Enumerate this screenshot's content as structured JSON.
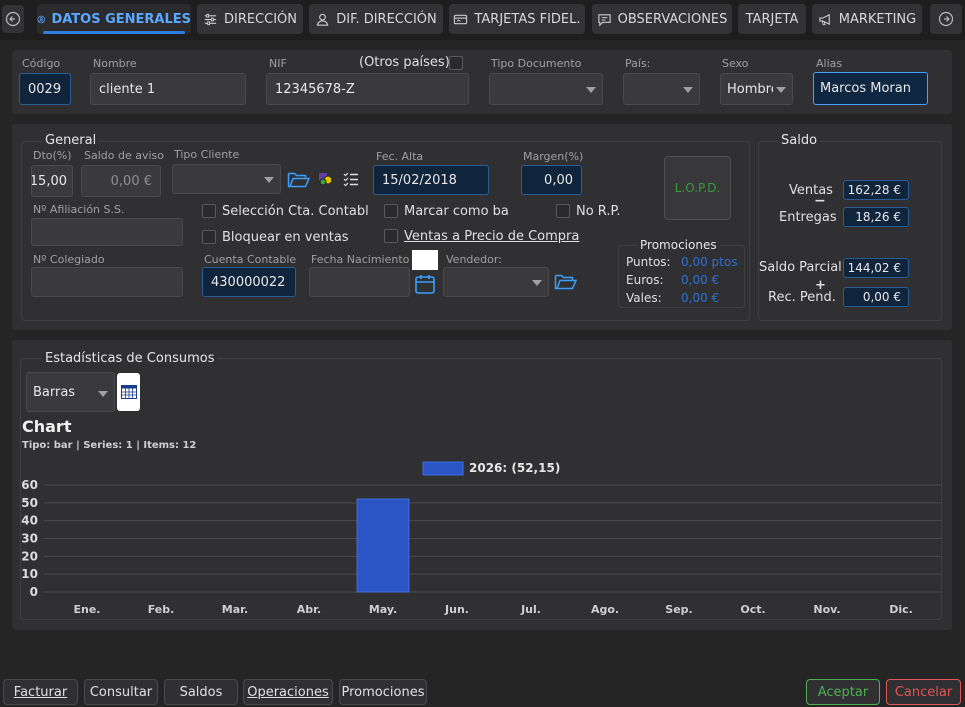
{
  "tabs": [
    {
      "label": "DATOS GENERALES",
      "icon": "user-circle-icon"
    },
    {
      "label": "DIRECCIÓN",
      "icon": "sliders-icon"
    },
    {
      "label": "DIF. DIRECCIÓN",
      "icon": "user-icon"
    },
    {
      "label": "TARJETAS FIDEL.",
      "icon": "card-icon"
    },
    {
      "label": "OBSERVACIONES",
      "icon": "note-icon"
    },
    {
      "label": "TARJETA",
      "icon": ""
    },
    {
      "label": "MARKETING",
      "icon": "megaphone-icon"
    }
  ],
  "header": {
    "codigo_label": "Código",
    "codigo": "0029",
    "nombre_label": "Nombre",
    "nombre": "cliente 1",
    "nif_label": "NIF",
    "nif": "12345678-Z",
    "otros_paises_label": "(Otros países)",
    "tipo_doc_label": "Tipo Documento",
    "tipo_doc": "",
    "pais_label": "País:",
    "pais": "",
    "sexo_label": "Sexo",
    "sexo": "Hombre",
    "alias_label": "Alias",
    "alias": "Marcos Moran"
  },
  "general": {
    "title": "General",
    "dto_label": "Dto(%)",
    "dto": "15,00",
    "saldo_aviso_label": "Saldo de aviso",
    "saldo_aviso": "0,00 €",
    "tipo_cliente_label": "Tipo Cliente",
    "tipo_cliente": "",
    "fec_alta_label": "Fec. Alta",
    "fec_alta": "15/02/2018",
    "margen_label": "Margen(%)",
    "margen": "0,00",
    "lopd": "L.O.P.D.",
    "afiliacion_label": "Nº Afiliación S.S.",
    "afiliacion": "",
    "colegiado_label": "Nº Colegiado",
    "colegiado": "",
    "seleccion_cta": "Selección Cta. Contabl",
    "bloquear_ventas": "Bloquear en ventas",
    "marcar_como": "Marcar como ba",
    "ventas_precio_compra": "Ventas a Precio de Compra",
    "no_rp": "No R.P.",
    "cuenta_contable_label": "Cuenta Contable",
    "cuenta_contable": "430000022",
    "fecha_nacimiento_label": "Fecha Nacimiento",
    "fecha_nacimiento": "",
    "vendedor_label": "Vendedor:",
    "vendedor": "",
    "promociones_title": "Promociones",
    "puntos_label": "Puntos:",
    "puntos": "0,00  ptos",
    "euros_label": "Euros:",
    "euros": "0,00  €",
    "vales_label": "Vales:",
    "vales": "0,00  €"
  },
  "saldo": {
    "title": "Saldo",
    "ventas_label": "Ventas",
    "ventas": "162,28 €",
    "entregas_label": "Entregas",
    "entregas": "18,26 €",
    "parcial_label": "Saldo Parcial",
    "parcial": "144,02 €",
    "rec_pend_label": "Rec. Pend.",
    "rec_pend": "0,00 €",
    "minus_sign": "−",
    "plus_sign": "+"
  },
  "estadisticas": {
    "title": "Estadísticas de Consumos",
    "chart_type_select": "Barras"
  },
  "chart_data": {
    "type": "bar",
    "title": "Chart",
    "subtitle": "Tipo: bar | Series: 1 | Items: 12",
    "categories": [
      "Ene.",
      "Feb.",
      "Mar.",
      "Abr.",
      "May.",
      "Jun.",
      "Jul.",
      "Ago.",
      "Sep.",
      "Oct.",
      "Nov.",
      "Dic."
    ],
    "series": [
      {
        "name": "2026",
        "values": [
          0,
          0,
          0,
          0,
          52.15,
          0,
          0,
          0,
          0,
          0,
          0,
          0
        ],
        "color": "#2b55c4"
      }
    ],
    "legend_label": "2026: (52,15)",
    "legend_position": "top-center",
    "yticks": [
      0,
      10,
      20,
      30,
      40,
      50,
      60
    ],
    "ylim": [
      0,
      60
    ],
    "grid": true
  },
  "footer": {
    "facturar": "Facturar",
    "consultar": "Consultar",
    "saldos": "Saldos",
    "operaciones": "Operaciones",
    "promociones": "Promociones",
    "aceptar": "Aceptar",
    "cancelar": "Cancelar"
  },
  "colors": {
    "accent": "#2f7de1",
    "aceptar": "#4caf50",
    "cancelar": "#e05555",
    "lopd": "#3a9a3a",
    "promo_value": "#2f6fd0"
  }
}
